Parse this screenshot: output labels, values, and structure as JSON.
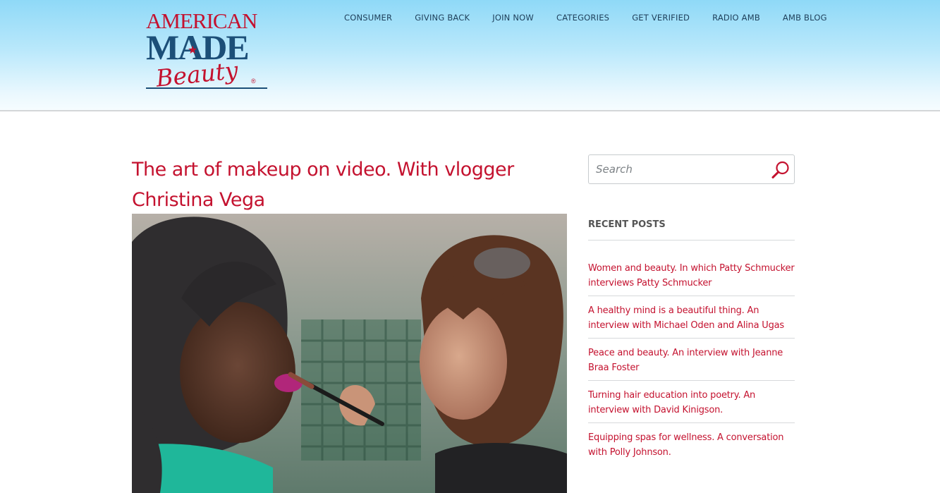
{
  "logo": {
    "line1": "AMERICAN",
    "line2": "MADE",
    "line3": "Beauty",
    "registered": "®"
  },
  "nav": {
    "items": [
      {
        "label": "CONSUMER"
      },
      {
        "label": "GIVING BACK"
      },
      {
        "label": "JOIN NOW"
      },
      {
        "label": "CATEGORIES"
      },
      {
        "label": "GET VERIFIED"
      },
      {
        "label": "RADIO AMB"
      },
      {
        "label": "AMB BLOG"
      }
    ]
  },
  "article": {
    "title": "The art of makeup on video. With vlogger Christina Vega"
  },
  "sidebar": {
    "search": {
      "placeholder": "Search",
      "icon": "search-icon"
    },
    "recent_heading": "RECENT POSTS",
    "recent_posts": [
      {
        "title": "Women and beauty. In which Patty Schmucker interviews Patty Schmucker"
      },
      {
        "title": "A healthy mind is a beautiful thing. An interview with Michael Oden and Alina Ugas"
      },
      {
        "title": "Peace and beauty. An interview with Jeanne Braa Foster"
      },
      {
        "title": "Turning hair education into poetry. An interview with David Kinigson."
      },
      {
        "title": "Equipping spas for wellness. A conversation with Polly Johnson."
      }
    ]
  },
  "colors": {
    "accent": "#c4122f",
    "navy": "#1c4f78",
    "header_top": "#8fd9f7",
    "header_bottom": "#f6fcff"
  }
}
